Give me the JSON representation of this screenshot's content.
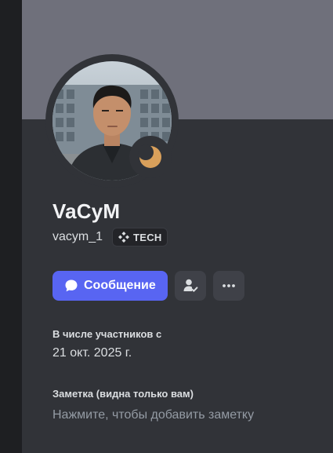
{
  "profile": {
    "display_name": "VaCyM",
    "username": "vacym_1",
    "tag": {
      "label": "TECH",
      "icon": "diamond-grid-icon"
    },
    "status": {
      "state": "idle",
      "icon": "moon-icon",
      "color": "#d9a05b"
    },
    "avatar": {
      "alt": "user-avatar-photo"
    }
  },
  "actions": {
    "message_label": "Сообщение",
    "message_icon": "speech-bubble-icon",
    "friend_icon": "user-check-icon",
    "more_icon": "ellipsis-icon"
  },
  "member_since": {
    "label": "В числе участников с",
    "value": "21 окт. 2025 г."
  },
  "note": {
    "label": "Заметка (видна только вам)",
    "placeholder": "Нажмите, чтобы добавить заметку",
    "value": ""
  },
  "colors": {
    "accent": "#5865f2",
    "banner": "#6f707b",
    "panel": "#313338"
  }
}
